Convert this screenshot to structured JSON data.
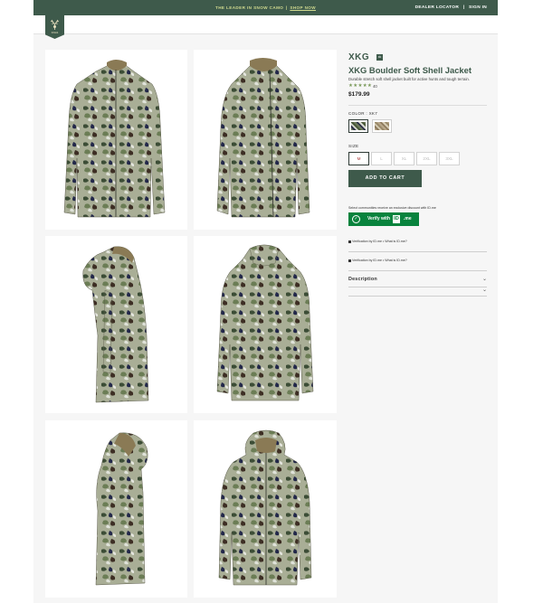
{
  "topbar": {
    "promo_text": "THE LEADER IN SNOW CAMO",
    "separator": "|",
    "promo_link": "SHOP NOW",
    "dealer_locator": "DEALER LOCATOR",
    "util_separator": "|",
    "sign_in": "SIGN IN"
  },
  "colors": {
    "brand_green": "#3e5a4b",
    "promo_text": "#cfd98e",
    "idme_green": "#08833d"
  },
  "logo": {
    "icon": "elk-antler-icon",
    "text": "KINGS"
  },
  "gallery": {
    "images": [
      "jacket-front-view",
      "jacket-front-three-quarter-view",
      "jacket-left-side-view",
      "jacket-back-view",
      "jacket-side-hood-up-view",
      "jacket-front-hood-up-view"
    ]
  },
  "product": {
    "brand": "XKG",
    "brand_mark": "xk",
    "title": "XKG Boulder Soft Shell Jacket",
    "description": "Durable stretch soft shell jacket built for active hunts and tough terrain.",
    "stars": "★★★★★",
    "review_count": "40",
    "rating": 5,
    "price": "$179.99"
  },
  "color_option": {
    "label": "COLOR : XK7",
    "swatches": [
      {
        "name": "XK7",
        "selected": true,
        "color": "#6d7a5c"
      },
      {
        "name": "Desert",
        "selected": false,
        "color": "#b8a78a"
      }
    ]
  },
  "size_option": {
    "label": "SIZE",
    "sizes": [
      "M",
      "L",
      "XL",
      "2XL",
      "3XL"
    ],
    "selected": "M"
  },
  "cart": {
    "label": "ADD TO CART"
  },
  "idme": {
    "note": "Select communities receive an exclusive discount with ID.me",
    "button_label": "Verify with",
    "logo_text": "ID",
    "logo_rest": ".me",
    "verification_1": "Verification by ID.me • What is ID.me?",
    "verification_2": "Verification by ID.me • What is ID.me?"
  },
  "accordion": {
    "description_label": "Description"
  }
}
